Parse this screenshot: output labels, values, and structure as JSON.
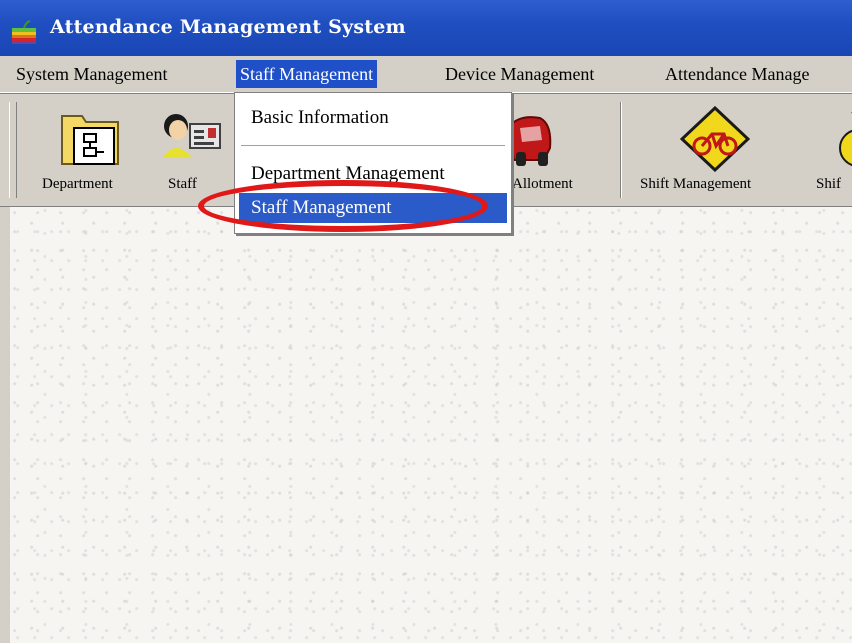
{
  "window": {
    "title": "Attendance Management System"
  },
  "menubar": {
    "items": [
      {
        "label": "System Management"
      },
      {
        "label": "Staff Management"
      },
      {
        "label": "Device Management"
      },
      {
        "label": "Attendance Manage"
      }
    ]
  },
  "toolbar": {
    "buttons": [
      {
        "label": "Department",
        "icon": "department-icon"
      },
      {
        "label": "Staff",
        "icon": "staff-icon"
      },
      {
        "label": "Allotment",
        "icon": "car-icon"
      },
      {
        "label": "Shift Management",
        "icon": "bicycle-sign-icon"
      },
      {
        "label": "Shif",
        "icon": "shift-icon"
      }
    ]
  },
  "dropdown": {
    "items": [
      {
        "label": "Basic Information"
      },
      {
        "label": "Department Management"
      },
      {
        "label": "Staff Management",
        "selected": true
      }
    ]
  },
  "colors": {
    "titlebar": "#1f4fc0",
    "menu_highlight": "#2050c8",
    "highlight_ellipse": "#e01818"
  }
}
